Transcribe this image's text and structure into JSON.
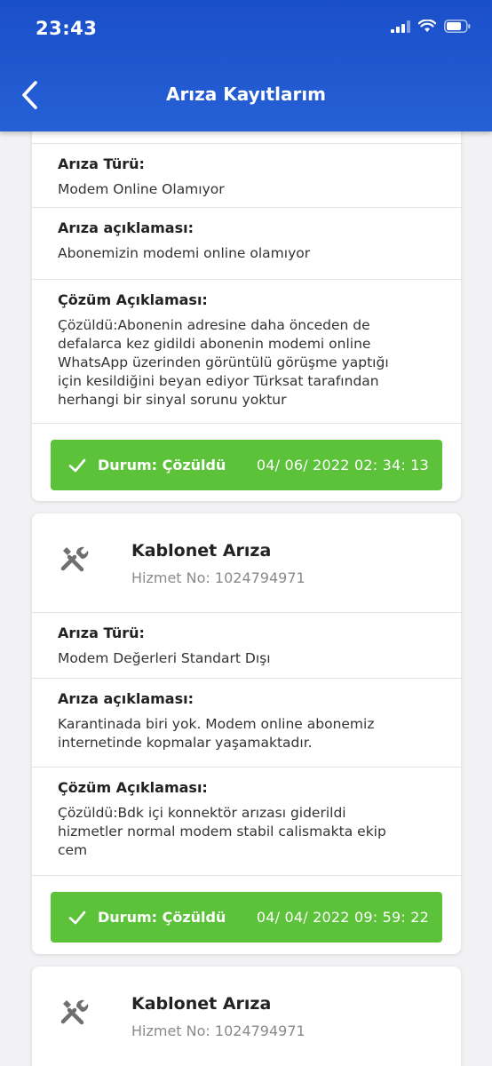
{
  "status_bar": {
    "time": "23:43"
  },
  "header": {
    "title": "Arıza Kayıtlarım"
  },
  "labels": {
    "fault_type": "Arıza Türü:",
    "fault_desc": "Arıza açıklaması:",
    "solution_desc": "Çözüm Açıklaması:"
  },
  "records": [
    {
      "fault_type": "Modem Online Olamıyor",
      "fault_desc": "Abonemizin modemi online olamıyor",
      "solution_lines": [
        "Çözüldü:Abonenin adresine daha önceden de",
        "defalarca kez gidildi abonenin modemi online",
        "WhatsApp üzerinden görüntülü görüşme yaptığı",
        "için kesildiğini beyan ediyor Türksat tarafından",
        "herhangi bir sinyal sorunu yoktur"
      ],
      "status_label": "Durum: Çözüldü",
      "status_date": "04/ 06/ 2022 02: 34: 13"
    },
    {
      "service_name": "Kablonet Arıza",
      "service_no": "Hizmet No: 1024794971",
      "fault_type": "Modem Değerleri Standart Dışı",
      "fault_desc_lines": [
        "Karantinada biri yok. Modem online abonemiz",
        "internetinde kopmalar yaşamaktadır."
      ],
      "solution_lines": [
        "Çözüldü:Bdk içi konnektör arızası giderildi",
        "hizmetler normal modem stabil calismakta ekip",
        "cem"
      ],
      "status_label": "Durum: Çözüldü",
      "status_date": "04/ 04/ 2022 09: 59: 22"
    },
    {
      "service_name": "Kablonet Arıza",
      "service_no": "Hizmet No: 1024794971"
    }
  ],
  "colors": {
    "header": "#1a4fc9",
    "status_ok": "#5cc23a"
  },
  "icons": [
    "back-chevron-icon",
    "tools-icon",
    "check-icon",
    "signal-icon",
    "wifi-icon",
    "battery-icon"
  ]
}
